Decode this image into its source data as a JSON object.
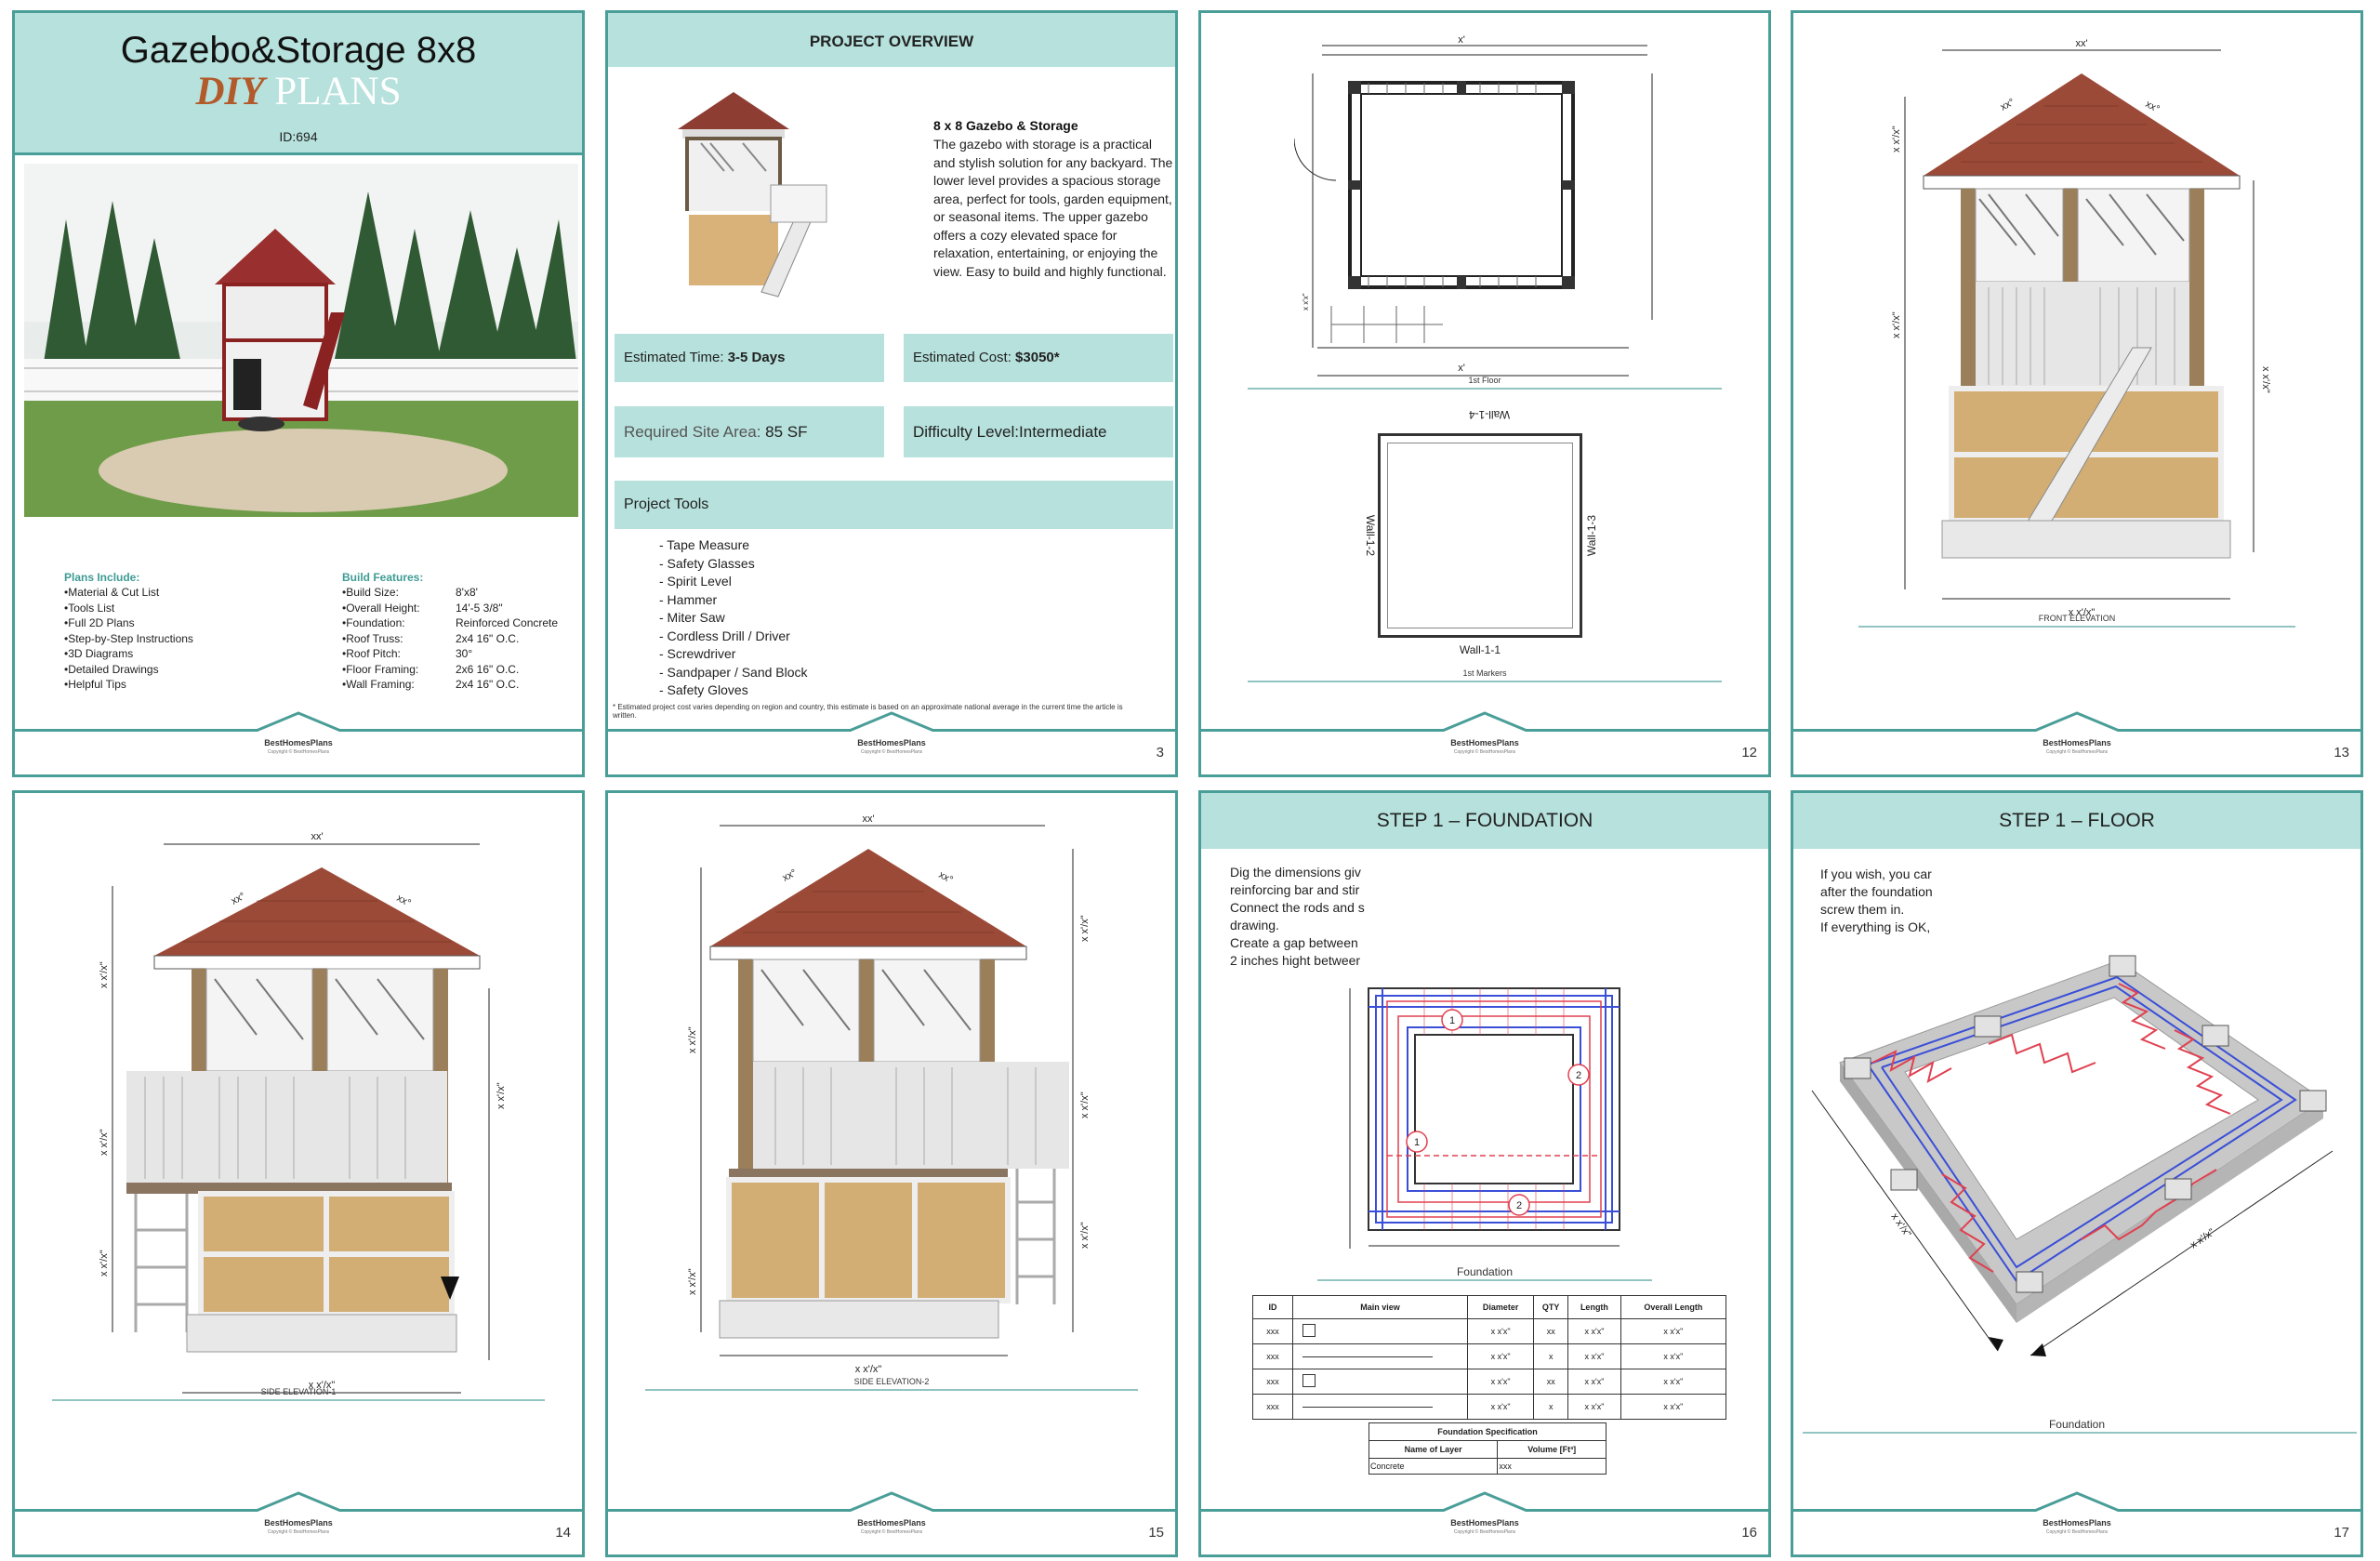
{
  "cover": {
    "title": "Gazebo&Storage 8x8",
    "diy": "DIY",
    "plans": "PLANS",
    "id": "ID:694",
    "plans_include_title": "Plans Include:",
    "plans_include": [
      "•Material & Cut List",
      "•Tools List",
      "•Full 2D Plans",
      "•Step-by-Step Instructions",
      "•3D Diagrams",
      "•Detailed Drawings",
      "•Helpful Tips"
    ],
    "build_features_title": "Build Features:",
    "build_features": [
      {
        "k": "•Build Size:",
        "v": "8'x8'"
      },
      {
        "k": "•Overall Height:",
        "v": "14'-5 3/8\""
      },
      {
        "k": "•Foundation:",
        "v": "Reinforced Concrete"
      },
      {
        "k": "•Roof Truss:",
        "v": "2x4 16\" O.C."
      },
      {
        "k": "•Roof Pitch:",
        "v": "30°"
      },
      {
        "k": "•Floor Framing:",
        "v": "2x6 16\" O.C."
      },
      {
        "k": "•Wall Framing:",
        "v": "2x4 16\" O.C."
      }
    ]
  },
  "overview": {
    "header": "PROJECT OVERVIEW",
    "title": "8 x 8 Gazebo & Storage",
    "description": "The gazebo with storage is a practical and stylish solution for any backyard. The lower level provides a spacious storage area, perfect for tools, garden equipment, or seasonal items. The upper gazebo offers a cozy elevated space for relaxation, entertaining, or enjoying the view. Easy to build and highly functional.",
    "time_label": "Estimated Time: ",
    "time_value": "3-5 Days",
    "cost_label": "Estimated Cost: ",
    "cost_value": "$3050*",
    "site_label": "Required Site Area: ",
    "site_value": "85 SF",
    "difficulty": "Difficulty Level:Intermediate",
    "tools_title": "Project Tools",
    "tools": [
      "- Tape Measure",
      "- Safety Glasses",
      "- Spirit Level",
      "- Hammer",
      "- Miter Saw",
      "- Cordless Drill / Driver",
      "- Screwdriver",
      "- Sandpaper / Sand Block",
      "- Safety Gloves"
    ],
    "footnote": "* Estimated project cost varies depending on region and country, this estimate is based on an approximate national average in the current time the article is written."
  },
  "footer": {
    "brand": "BestHomesPlans",
    "copy": "Copyright © BestHomesPlans"
  },
  "page_numbers": {
    "p2": "3",
    "p3": "12",
    "p4": "13",
    "p5": "14",
    "p6": "15",
    "p7": "16",
    "p8": "17"
  },
  "floorplan": {
    "caption1": "1st Floor",
    "caption2": "1st Markers",
    "wall_top": "Wall-1-4",
    "wall_left": "Wall-1-2",
    "wall_right": "Wall-1-3",
    "wall_bottom": "Wall-1-1",
    "dim_x": "x'",
    "dim_xx": "x x'x\""
  },
  "elevations": {
    "front": "FRONT ELEVATION",
    "side1": "SIDE ELEVATION-1",
    "side2": "SIDE ELEVATION-2",
    "dim_top": "xx'",
    "dim_angle": "xx°",
    "dim_bottom": "x x'/x\"",
    "dim_vert": "x x'/x\""
  },
  "step_foundation": {
    "header": "STEP 1 – FOUNDATION",
    "lines": [
      "Dig the dimensions giv",
      "reinforcing bar and stir",
      "Connect the rods and s",
      "drawing.",
      "Create a gap between ",
      "2 inches hight betweer"
    ],
    "caption": "Foundation",
    "table_headers": [
      "ID",
      "Main view",
      "Diameter",
      "QTY",
      "Length",
      "Overall Length"
    ],
    "table_rows": [
      [
        "xxx",
        "",
        "x x'x\"",
        "xx",
        "x x'x\"",
        "x x'x\""
      ],
      [
        "xxx",
        "",
        "x x'x\"",
        "x",
        "x x'x\"",
        "x x'x\""
      ],
      [
        "xxx",
        "",
        "x x'x\"",
        "xx",
        "x x'x\"",
        "x x'x\""
      ],
      [
        "xxx",
        "",
        "x x'x\"",
        "x",
        "x x'x\"",
        "x x'x\""
      ]
    ],
    "spec_title": "Foundation Specification",
    "spec_headers": [
      "Name of Layer",
      "Volume [Ft³]"
    ],
    "spec_row": [
      "Concrete",
      "xxx"
    ],
    "markers": [
      "1",
      "2",
      "1",
      "2"
    ]
  },
  "step_floor": {
    "header": "STEP 1 –  FLOOR",
    "lines": [
      "If you wish, you car",
      "after the foundation",
      "screw them in.",
      "If everything is OK,"
    ],
    "caption": "Foundation",
    "dim1": "x x'/x\"",
    "dim2": "x x'/x\""
  }
}
